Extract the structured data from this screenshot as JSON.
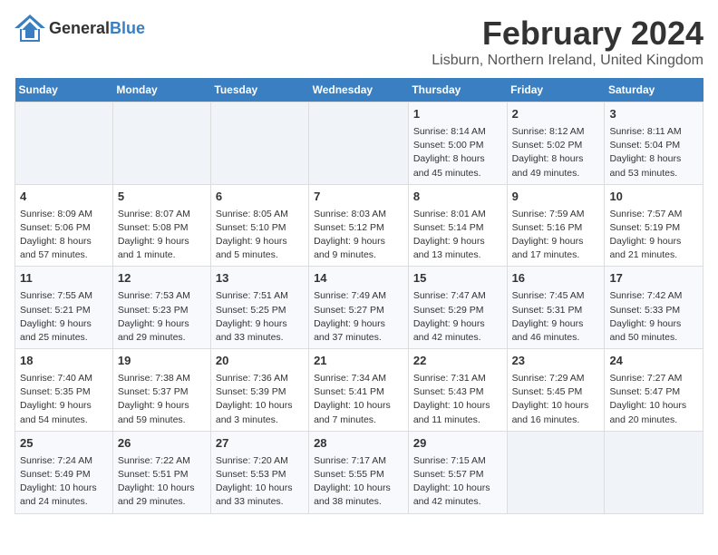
{
  "header": {
    "logo_general": "General",
    "logo_blue": "Blue",
    "title": "February 2024",
    "subtitle": "Lisburn, Northern Ireland, United Kingdom"
  },
  "calendar": {
    "weekdays": [
      "Sunday",
      "Monday",
      "Tuesday",
      "Wednesday",
      "Thursday",
      "Friday",
      "Saturday"
    ],
    "weeks": [
      [
        {
          "day": "",
          "content": ""
        },
        {
          "day": "",
          "content": ""
        },
        {
          "day": "",
          "content": ""
        },
        {
          "day": "",
          "content": ""
        },
        {
          "day": "1",
          "content": "Sunrise: 8:14 AM\nSunset: 5:00 PM\nDaylight: 8 hours\nand 45 minutes."
        },
        {
          "day": "2",
          "content": "Sunrise: 8:12 AM\nSunset: 5:02 PM\nDaylight: 8 hours\nand 49 minutes."
        },
        {
          "day": "3",
          "content": "Sunrise: 8:11 AM\nSunset: 5:04 PM\nDaylight: 8 hours\nand 53 minutes."
        }
      ],
      [
        {
          "day": "4",
          "content": "Sunrise: 8:09 AM\nSunset: 5:06 PM\nDaylight: 8 hours\nand 57 minutes."
        },
        {
          "day": "5",
          "content": "Sunrise: 8:07 AM\nSunset: 5:08 PM\nDaylight: 9 hours\nand 1 minute."
        },
        {
          "day": "6",
          "content": "Sunrise: 8:05 AM\nSunset: 5:10 PM\nDaylight: 9 hours\nand 5 minutes."
        },
        {
          "day": "7",
          "content": "Sunrise: 8:03 AM\nSunset: 5:12 PM\nDaylight: 9 hours\nand 9 minutes."
        },
        {
          "day": "8",
          "content": "Sunrise: 8:01 AM\nSunset: 5:14 PM\nDaylight: 9 hours\nand 13 minutes."
        },
        {
          "day": "9",
          "content": "Sunrise: 7:59 AM\nSunset: 5:16 PM\nDaylight: 9 hours\nand 17 minutes."
        },
        {
          "day": "10",
          "content": "Sunrise: 7:57 AM\nSunset: 5:19 PM\nDaylight: 9 hours\nand 21 minutes."
        }
      ],
      [
        {
          "day": "11",
          "content": "Sunrise: 7:55 AM\nSunset: 5:21 PM\nDaylight: 9 hours\nand 25 minutes."
        },
        {
          "day": "12",
          "content": "Sunrise: 7:53 AM\nSunset: 5:23 PM\nDaylight: 9 hours\nand 29 minutes."
        },
        {
          "day": "13",
          "content": "Sunrise: 7:51 AM\nSunset: 5:25 PM\nDaylight: 9 hours\nand 33 minutes."
        },
        {
          "day": "14",
          "content": "Sunrise: 7:49 AM\nSunset: 5:27 PM\nDaylight: 9 hours\nand 37 minutes."
        },
        {
          "day": "15",
          "content": "Sunrise: 7:47 AM\nSunset: 5:29 PM\nDaylight: 9 hours\nand 42 minutes."
        },
        {
          "day": "16",
          "content": "Sunrise: 7:45 AM\nSunset: 5:31 PM\nDaylight: 9 hours\nand 46 minutes."
        },
        {
          "day": "17",
          "content": "Sunrise: 7:42 AM\nSunset: 5:33 PM\nDaylight: 9 hours\nand 50 minutes."
        }
      ],
      [
        {
          "day": "18",
          "content": "Sunrise: 7:40 AM\nSunset: 5:35 PM\nDaylight: 9 hours\nand 54 minutes."
        },
        {
          "day": "19",
          "content": "Sunrise: 7:38 AM\nSunset: 5:37 PM\nDaylight: 9 hours\nand 59 minutes."
        },
        {
          "day": "20",
          "content": "Sunrise: 7:36 AM\nSunset: 5:39 PM\nDaylight: 10 hours\nand 3 minutes."
        },
        {
          "day": "21",
          "content": "Sunrise: 7:34 AM\nSunset: 5:41 PM\nDaylight: 10 hours\nand 7 minutes."
        },
        {
          "day": "22",
          "content": "Sunrise: 7:31 AM\nSunset: 5:43 PM\nDaylight: 10 hours\nand 11 minutes."
        },
        {
          "day": "23",
          "content": "Sunrise: 7:29 AM\nSunset: 5:45 PM\nDaylight: 10 hours\nand 16 minutes."
        },
        {
          "day": "24",
          "content": "Sunrise: 7:27 AM\nSunset: 5:47 PM\nDaylight: 10 hours\nand 20 minutes."
        }
      ],
      [
        {
          "day": "25",
          "content": "Sunrise: 7:24 AM\nSunset: 5:49 PM\nDaylight: 10 hours\nand 24 minutes."
        },
        {
          "day": "26",
          "content": "Sunrise: 7:22 AM\nSunset: 5:51 PM\nDaylight: 10 hours\nand 29 minutes."
        },
        {
          "day": "27",
          "content": "Sunrise: 7:20 AM\nSunset: 5:53 PM\nDaylight: 10 hours\nand 33 minutes."
        },
        {
          "day": "28",
          "content": "Sunrise: 7:17 AM\nSunset: 5:55 PM\nDaylight: 10 hours\nand 38 minutes."
        },
        {
          "day": "29",
          "content": "Sunrise: 7:15 AM\nSunset: 5:57 PM\nDaylight: 10 hours\nand 42 minutes."
        },
        {
          "day": "",
          "content": ""
        },
        {
          "day": "",
          "content": ""
        }
      ]
    ]
  }
}
